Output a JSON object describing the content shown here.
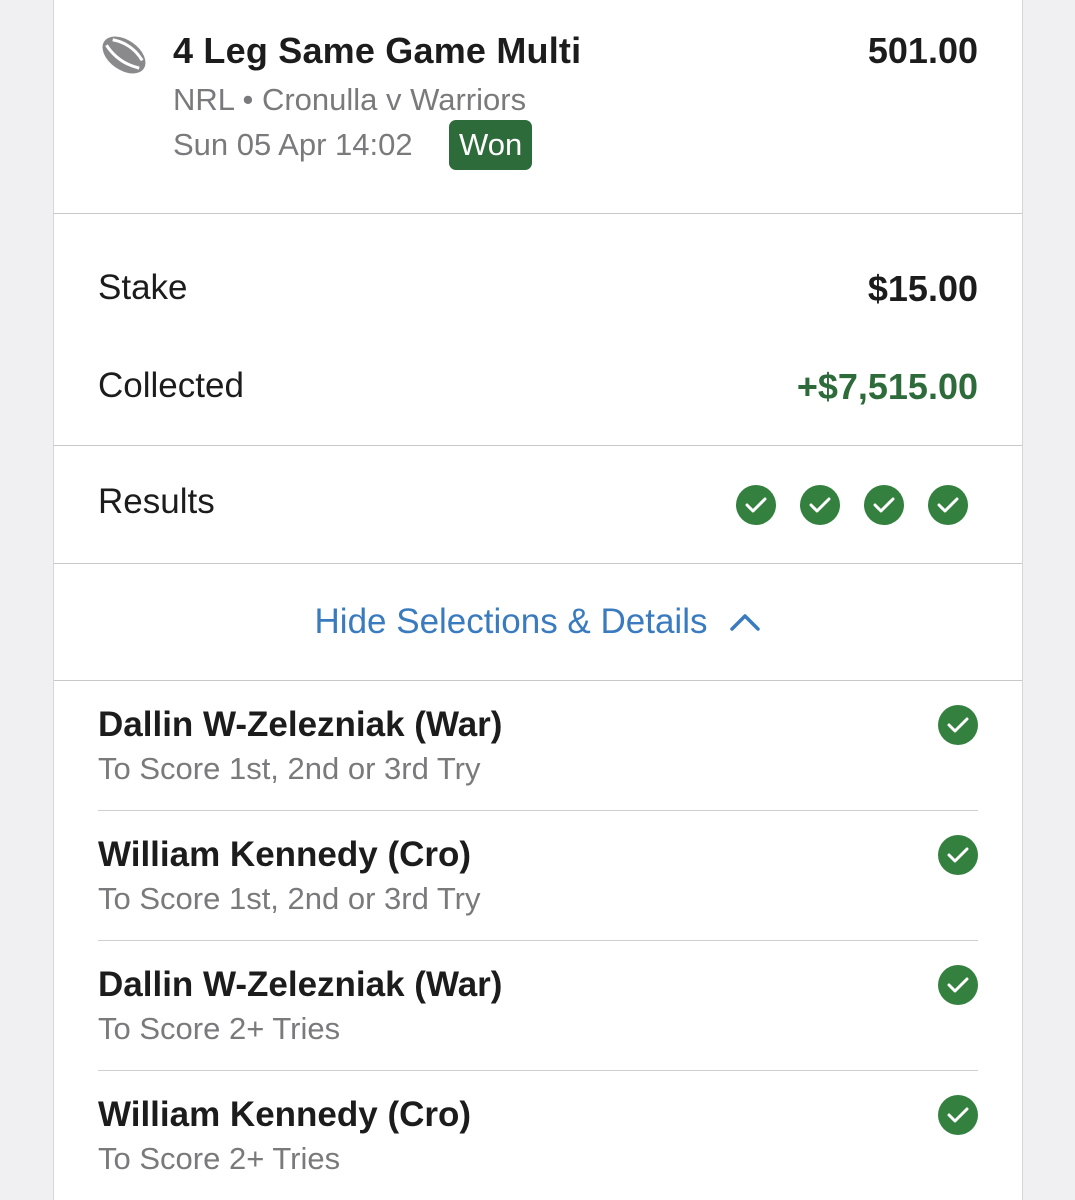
{
  "bet": {
    "title": "4 Leg Same Game Multi",
    "odds": "501.00",
    "event": "NRL • Cronulla v Warriors",
    "date": "Sun 05 Apr 14:02",
    "status": "Won",
    "sport_icon": "rugby-ball-icon"
  },
  "amounts": {
    "stake_label": "Stake",
    "stake_value": "$15.00",
    "collected_label": "Collected",
    "collected_value": "+$7,515.00"
  },
  "results": {
    "label": "Results",
    "legs": [
      "won",
      "won",
      "won",
      "won"
    ]
  },
  "toggle": {
    "label": "Hide Selections & Details"
  },
  "selections": [
    {
      "name": "Dallin W-Zelezniak (War)",
      "market": "To Score 1st, 2nd or 3rd Try",
      "result": "won"
    },
    {
      "name": "William Kennedy (Cro)",
      "market": "To Score 1st, 2nd or 3rd Try",
      "result": "won"
    },
    {
      "name": "Dallin W-Zelezniak (War)",
      "market": "To Score 2+ Tries",
      "result": "won"
    },
    {
      "name": "William Kennedy (Cro)",
      "market": "To Score 2+ Tries",
      "result": "won"
    }
  ],
  "colors": {
    "won_green": "#2e6b3a",
    "check_green": "#33803f",
    "link_blue": "#3a7bbf",
    "muted_text": "#7a7a7c"
  }
}
